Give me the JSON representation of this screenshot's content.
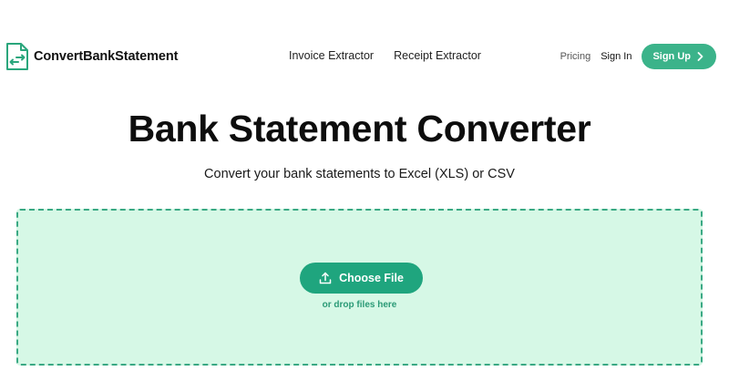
{
  "colors": {
    "accent": "#3bb38a",
    "button_primary": "#1fa57e",
    "dropzone_bg": "#d6f8e6",
    "dropzone_border": "#3aa984"
  },
  "header": {
    "logo_text": "ConvertBankStatement",
    "logo_icon": "document-exchange-icon",
    "nav": [
      {
        "label": "Invoice Extractor"
      },
      {
        "label": "Receipt Extractor"
      }
    ],
    "pricing_label": "Pricing",
    "signin_label": "Sign In",
    "signup_label": "Sign Up",
    "signup_icon": "chevron-right-icon"
  },
  "hero": {
    "title": "Bank Statement Converter",
    "subtitle": "Convert your bank statements to Excel (XLS) or CSV"
  },
  "upload": {
    "button_label": "Choose File",
    "button_icon": "upload-icon",
    "hint": "or drop files here"
  }
}
